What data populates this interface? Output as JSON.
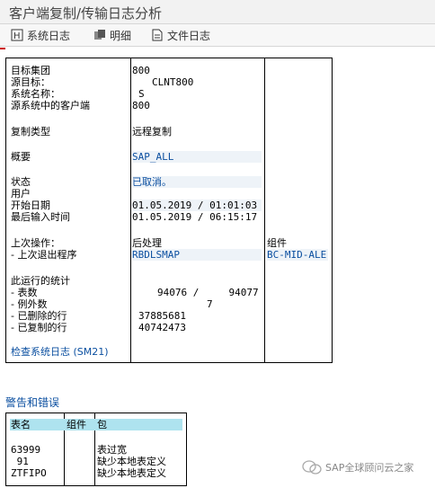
{
  "window": {
    "title": "客户端复制/传输日志分析"
  },
  "toolbar": {
    "system_log": "系统日志",
    "details": "明细",
    "file_log": "文件日志"
  },
  "info": {
    "target_client_label": "目标集团",
    "target_client_value": "800",
    "source_target_label": "源目标：",
    "source_target_value": "CLNT800",
    "system_name_label": "系统名称：",
    "system_name_value": "S",
    "source_client_label": "源系统中的客户端",
    "source_client_value": "800",
    "copy_type_label": "复制类型",
    "copy_type_value": "远程复制",
    "profile_label": "概要",
    "profile_value": "SAP_ALL",
    "status_label": "状态",
    "status_value": "已取消。",
    "user_label": "用户",
    "user_value": "",
    "start_date_label": "开始日期",
    "start_date_value": "01.05.2019 / 01:01:03",
    "last_entry_label": "最后输入时间",
    "last_entry_value": "01.05.2019 / 06:15:17",
    "last_op_label": "上次操作：",
    "last_op_value": "后处理",
    "component_label": "组件",
    "last_exit_label": "- 上次退出程序",
    "last_exit_value": "RBDLSMAP",
    "component_value": "BC-MID-ALE",
    "stats_label": "此运行的统计",
    "tables_label": "- 表数",
    "tables_value": "94076 /     94077",
    "exceptions_label": "- 例外数",
    "exceptions_value": "7",
    "deleted_label": "- 已删除的行",
    "deleted_value": "37885681",
    "copied_label": "- 已复制的行",
    "copied_value": "40742473",
    "syslog_link": "检查系统日志 (SM21)"
  },
  "warnings": {
    "title": "警告和错误",
    "headers": [
      "表名",
      "组件",
      "包"
    ],
    "rows": [
      [
        "63999",
        "",
        "表过宽"
      ],
      [
        " 91",
        "",
        "缺少本地表定义"
      ],
      [
        "ZTFIPO",
        "",
        "缺少本地表定义"
      ]
    ]
  },
  "watermark": {
    "text": "SAP全球顾问云之家",
    "icon": "wechat-icon"
  }
}
